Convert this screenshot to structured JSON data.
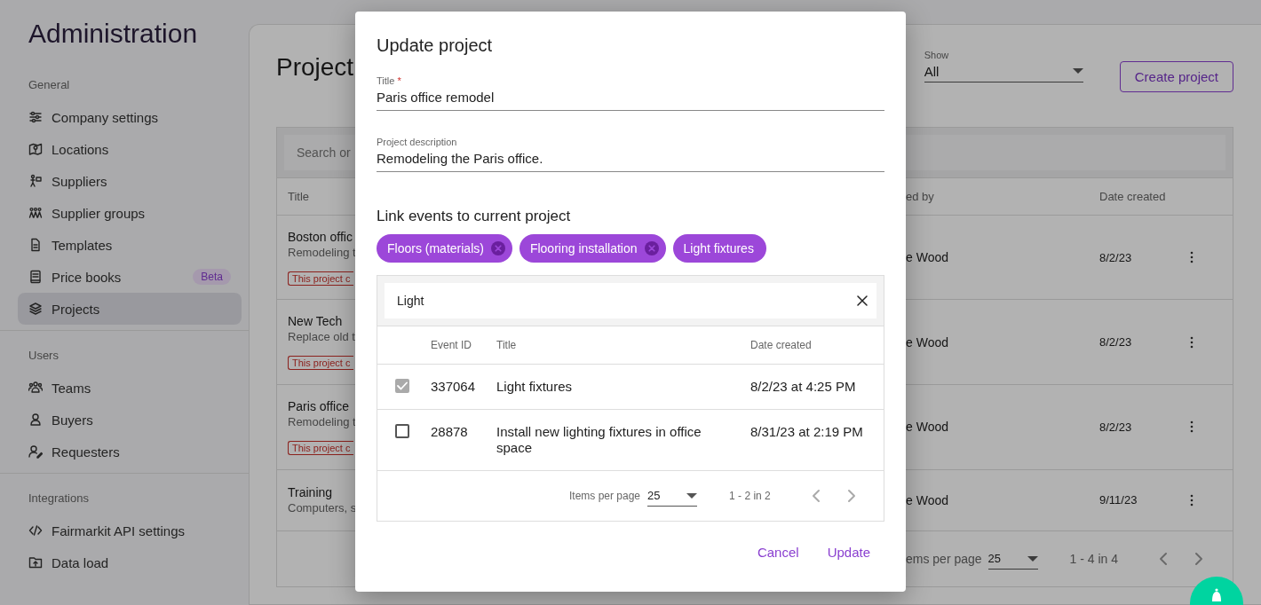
{
  "sidebar": {
    "title": "Administration",
    "sections": [
      {
        "label": "General",
        "items": [
          {
            "label": "Company settings",
            "selected": false
          },
          {
            "label": "Locations",
            "selected": false
          },
          {
            "label": "Suppliers",
            "selected": false
          },
          {
            "label": "Supplier groups",
            "selected": false
          },
          {
            "label": "Templates",
            "selected": false
          },
          {
            "label": "Price books",
            "selected": false,
            "badge": "Beta"
          },
          {
            "label": "Projects",
            "selected": true
          }
        ]
      },
      {
        "label": "Users",
        "items": [
          {
            "label": "Teams",
            "selected": false
          },
          {
            "label": "Buyers",
            "selected": false
          },
          {
            "label": "Requesters",
            "selected": false
          }
        ]
      },
      {
        "label": "Integrations",
        "items": [
          {
            "label": "Fairmarkit API settings",
            "selected": false
          },
          {
            "label": "Data load",
            "selected": false
          }
        ]
      }
    ]
  },
  "main": {
    "title": "Project",
    "show": {
      "label": "Show",
      "value": "All"
    },
    "create_button": "Create project",
    "search": {
      "placeholder": "Search or"
    },
    "columns": [
      "Title",
      "ed by",
      "Date created"
    ],
    "rows": [
      {
        "title": "Boston offic",
        "description": "Remodeling t",
        "warning": "This project c",
        "created_by": "e Wood",
        "date": "8/2/23"
      },
      {
        "title": "New Tech",
        "description": "Replace old t",
        "warning": "This project c",
        "created_by": "e Wood",
        "date": "8/2/23"
      },
      {
        "title": "Paris office",
        "description": "Remodeling t",
        "warning": "This project c",
        "created_by": "e Wood",
        "date": "8/2/23"
      },
      {
        "title": "Training",
        "description": "Computers, s",
        "created_by": "e Wood",
        "date": "9/11/23"
      }
    ],
    "pagination": {
      "label": "ems per page",
      "per_page": "25",
      "range": "1 - 4 in 4"
    }
  },
  "dialog": {
    "title": "Update project",
    "fields": [
      {
        "label": "Title",
        "required_mark": "*",
        "value": "Paris office remodel"
      },
      {
        "label": "Project description",
        "value": "Remodeling the Paris office."
      }
    ],
    "link_heading": "Link events to current project",
    "chips": [
      {
        "label": "Floors (materials)",
        "removable": true
      },
      {
        "label": "Flooring installation",
        "removable": true
      },
      {
        "label": "Light fixtures",
        "removable": false
      }
    ],
    "search": {
      "value": "Light"
    },
    "columns": [
      "Event ID",
      "Title",
      "Date created"
    ],
    "rows": [
      {
        "checked": true,
        "disabled": true,
        "event_id": "337064",
        "title": "Light fixtures",
        "date": "8/2/23 at 4:25 PM"
      },
      {
        "checked": false,
        "disabled": false,
        "event_id": "28878",
        "title": "Install new lighting fixtures in office space",
        "date": "8/31/23 at 2:19 PM"
      }
    ],
    "pagination": {
      "label": "Items per page",
      "per_page": "25",
      "range": "1 - 2 in 2"
    },
    "buttons": [
      "Cancel",
      "Update"
    ]
  }
}
